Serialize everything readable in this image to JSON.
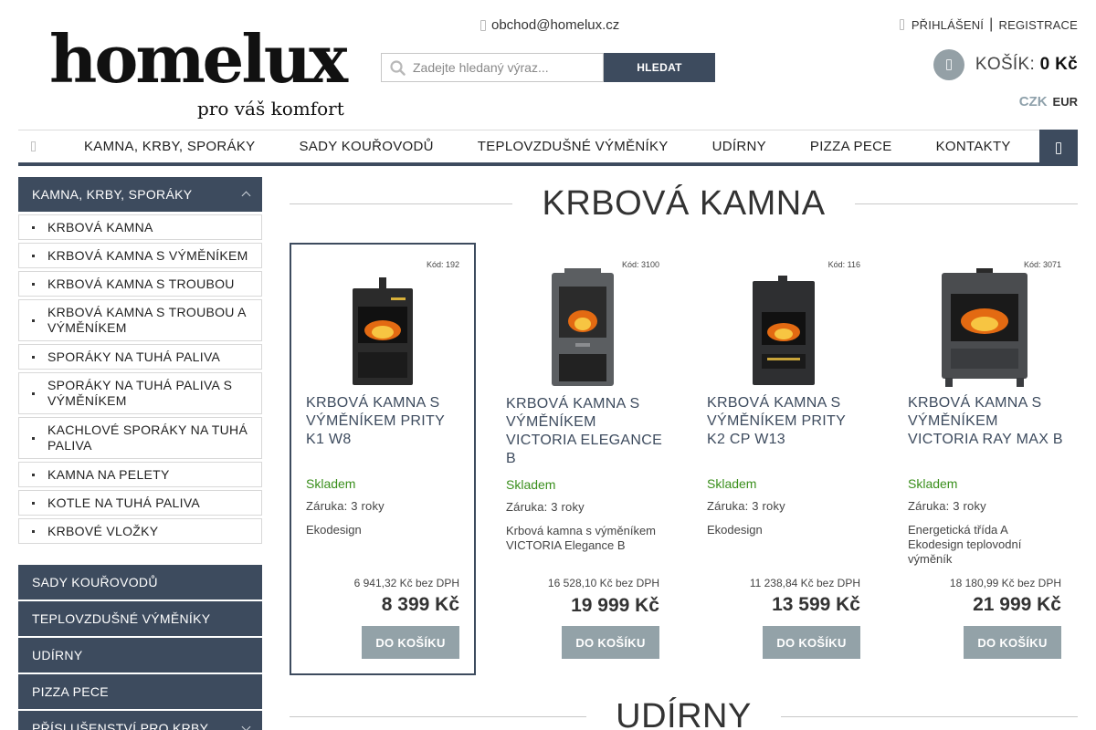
{
  "header": {
    "logo_text": "homelux",
    "logo_tagline": "pro váš komfort",
    "email": "obchod@homelux.cz",
    "search_placeholder": "Zadejte hledaný výraz...",
    "search_button": "HLEDAT",
    "login": "PŘIHLÁŠENÍ",
    "separator": "|",
    "register": "REGISTRACE",
    "cart_label": "KOŠÍK:",
    "cart_total": "0 Kč",
    "currency_active": "CZK",
    "currency_other": "EUR"
  },
  "nav": {
    "items": [
      "KAMNA, KRBY, SPORÁKY",
      "SADY KOUŘOVODŮ",
      "TEPLOVZDUŠNÉ VÝMĚNÍKY",
      "UDÍRNY",
      "PIZZA PECE",
      "KONTAKTY"
    ]
  },
  "sidebar": {
    "active_category": "KAMNA, KRBY, SPORÁKY",
    "sub_items": [
      "KRBOVÁ KAMNA",
      "KRBOVÁ KAMNA S VÝMĚNÍKEM",
      "KRBOVÁ KAMNA S TROUBOU",
      "KRBOVÁ KAMNA S TROUBOU A VÝMĚNÍKEM",
      "SPORÁKY NA TUHÁ PALIVA",
      "SPORÁKY NA TUHÁ PALIVA S VÝMĚNÍKEM",
      "KACHLOVÉ SPORÁKY NA TUHÁ PALIVA",
      "KAMNA NA PELETY",
      "KOTLE NA TUHÁ PALIVA",
      "KRBOVÉ VLOŽKY"
    ],
    "categories": [
      "SADY KOUŘOVODŮ",
      "TEPLOVZDUŠNÉ VÝMĚNÍKY",
      "UDÍRNY",
      "PIZZA PECE",
      "PŘÍSLUŠENSTVÍ PRO KRBY"
    ]
  },
  "main": {
    "section_title": "KRBOVÁ KAMNA",
    "next_section_title": "UDÍRNY",
    "products": [
      {
        "code": "Kód: 192",
        "name": "KRBOVÁ KAMNA S VÝMĚNÍKEM PRITY K1 W8",
        "stock": "Skladem",
        "warranty": "Záruka: 3 roky",
        "desc": "Ekodesign",
        "price_novat": "6 941,32 Kč bez DPH",
        "price": "8 399 Kč",
        "button": "DO KOŠÍKU",
        "stove_color": "#2b2b2b"
      },
      {
        "code": "Kód: 3100",
        "name": "KRBOVÁ KAMNA S VÝMĚNÍKEM VICTORIA ELEGANCE B",
        "stock": "Skladem",
        "warranty": "Záruka: 3 roky",
        "desc": "Krbová kamna s výměníkem VICTORIA Elegance B",
        "price_novat": "16 528,10 Kč bez DPH",
        "price": "19 999 Kč",
        "button": "DO KOŠÍKU",
        "stove_color": "#5b5e61"
      },
      {
        "code": "Kód: 116",
        "name": "KRBOVÁ KAMNA S VÝMĚNÍKEM PRITY K2 CP W13",
        "stock": "Skladem",
        "warranty": "Záruka: 3 roky",
        "desc": "Ekodesign",
        "price_novat": "11 238,84 Kč bez DPH",
        "price": "13 599 Kč",
        "button": "DO KOŠÍKU",
        "stove_color": "#2e2f31"
      },
      {
        "code": "Kód: 3071",
        "name": "KRBOVÁ KAMNA S VÝMĚNÍKEM VICTORIA RAY MAX B",
        "stock": "Skladem",
        "warranty": "Záruka: 3 roky",
        "desc": "Energetická třída A Ekodesign teplovodní výměník",
        "price_novat": "18 180,99 Kč bez DPH",
        "price": "21 999 Kč",
        "button": "DO KOŠÍKU",
        "stove_color": "#4a4c4f"
      }
    ]
  },
  "colors": {
    "accent": "#3d4b5e",
    "stock_green": "#3a8f1c",
    "button_gray": "#93a2a8"
  }
}
